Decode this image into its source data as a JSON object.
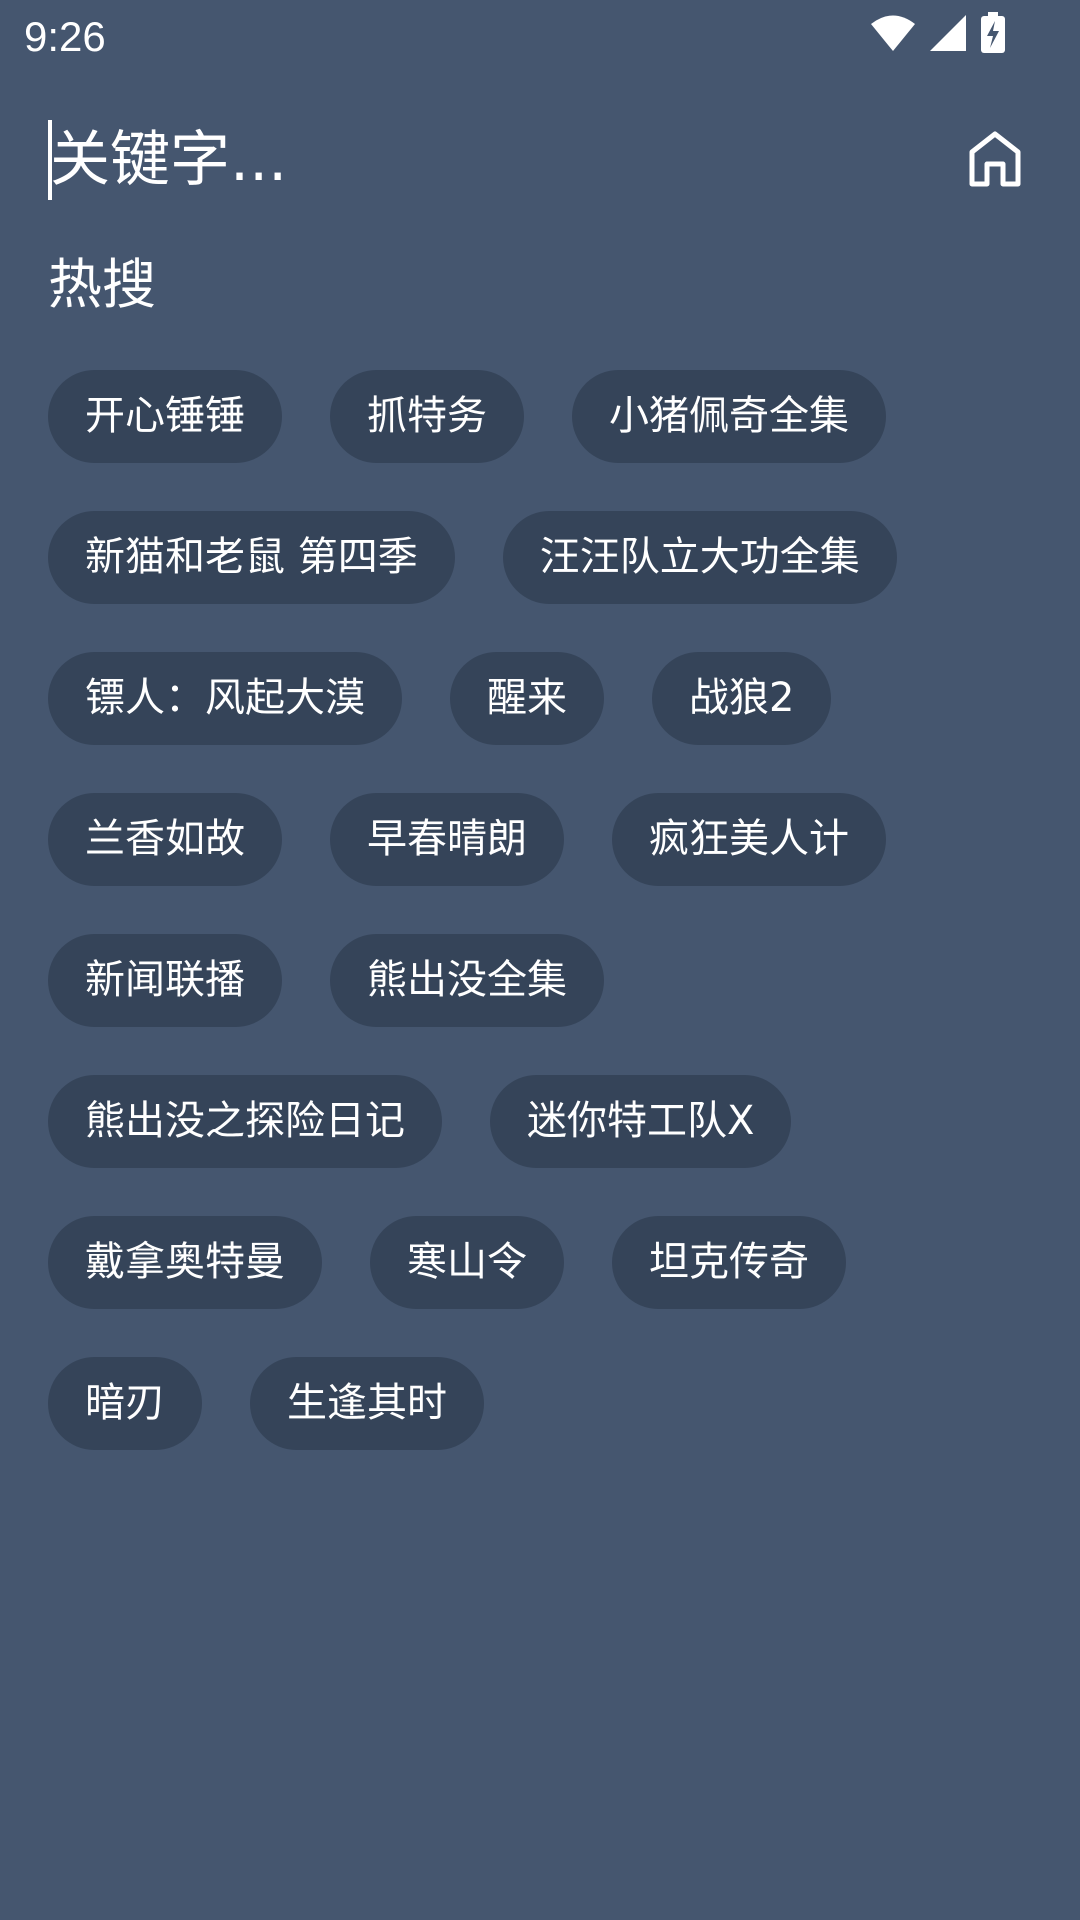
{
  "status_bar": {
    "time": "9:26",
    "icons": [
      "wifi-icon",
      "cellular-signal-icon",
      "battery-charging-icon"
    ]
  },
  "search": {
    "placeholder": "关键字...",
    "value": ""
  },
  "home_button": {
    "icon": "home-icon"
  },
  "hot_search": {
    "title": "热搜",
    "rows": [
      [
        "开心锤锤",
        "抓特务",
        "小猪佩奇全集"
      ],
      [
        "新猫和老鼠 第四季",
        "汪汪队立大功全集"
      ],
      [
        "镖人：风起大漠",
        "醒来",
        "战狼2"
      ],
      [
        "兰香如故",
        "早春晴朗",
        "疯狂美人计"
      ],
      [
        "新闻联播",
        "熊出没全集"
      ],
      [
        "熊出没之探险日记",
        "迷你特工队X"
      ],
      [
        "戴拿奥特曼",
        "寒山令",
        "坦克传奇"
      ],
      [
        "暗刃",
        "生逢其时"
      ]
    ]
  },
  "colors": {
    "background": "#45566f",
    "chip": "#354459",
    "text": "#ffffff"
  }
}
